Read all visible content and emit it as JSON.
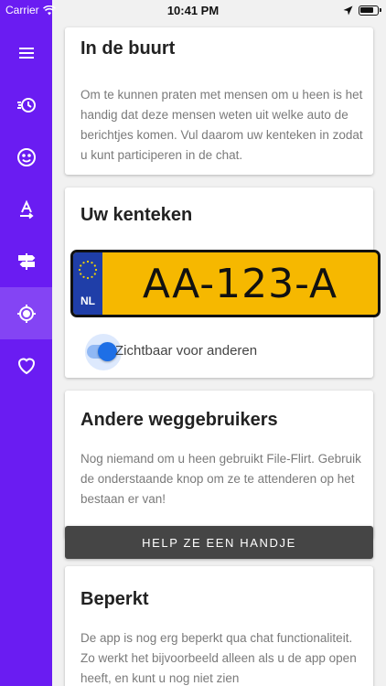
{
  "status": {
    "carrier": "Carrier",
    "time": "10:41 PM"
  },
  "sidebar": {
    "items": [
      {
        "icon": "menu-icon"
      },
      {
        "icon": "history-icon"
      },
      {
        "icon": "smiley-icon"
      },
      {
        "icon": "text-direction-icon"
      },
      {
        "icon": "signpost-icon"
      },
      {
        "icon": "location-target-icon",
        "active": true
      },
      {
        "icon": "heart-icon"
      }
    ],
    "color": "#6a1cf2"
  },
  "cards": {
    "nearby": {
      "title": "In de buurt",
      "text": "Om te kunnen praten met mensen om u heen is het handig dat deze mensen weten uit welke auto de berichtjes komen. Vul daarom uw kenteken in zodat u kunt participeren in de chat."
    },
    "plate": {
      "title": "Uw kenteken",
      "country": "NL",
      "number": "AA-123-A",
      "plate_color": "#f6b800",
      "toggle_label": "Zichtbaar voor anderen",
      "toggle_on": true
    },
    "others": {
      "title": "Andere weggebruikers",
      "text": "Nog niemand om u heen gebruikt File-Flirt. Gebruik de onderstaande knop om ze te attenderen op het bestaan er van!",
      "button": "HELP ZE EEN HANDJE"
    },
    "limited": {
      "title": "Beperkt",
      "text": "De app is nog erg beperkt qua chat functionaliteit. Zo werkt het bijvoorbeeld alleen als u de app open heeft, en kunt u nog niet zien"
    }
  }
}
